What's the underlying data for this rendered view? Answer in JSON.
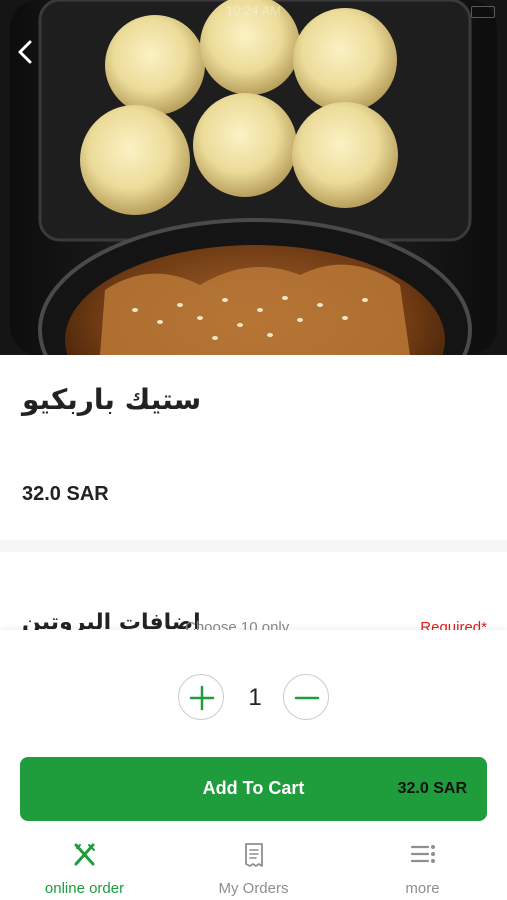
{
  "status_bar": {
    "time": "10:24 AM"
  },
  "product": {
    "title": "ستيك باربكيو",
    "price": "32.0 SAR"
  },
  "options_section": {
    "title": "اضافات البروتين",
    "hint": "Choose 10 only",
    "required": "Required*"
  },
  "quantity": {
    "value": "1"
  },
  "cart": {
    "label": "Add To Cart",
    "price": "32.0 SAR"
  },
  "tabs": [
    {
      "label": "online order",
      "icon": "fork-knife-icon",
      "active": true
    },
    {
      "label": "My Orders",
      "icon": "receipt-icon",
      "active": false
    },
    {
      "label": "more",
      "icon": "more-menu-icon",
      "active": false
    }
  ],
  "colors": {
    "accent": "#1f9c3c",
    "required": "#e02020",
    "inactive_tab": "#8e8e93"
  }
}
